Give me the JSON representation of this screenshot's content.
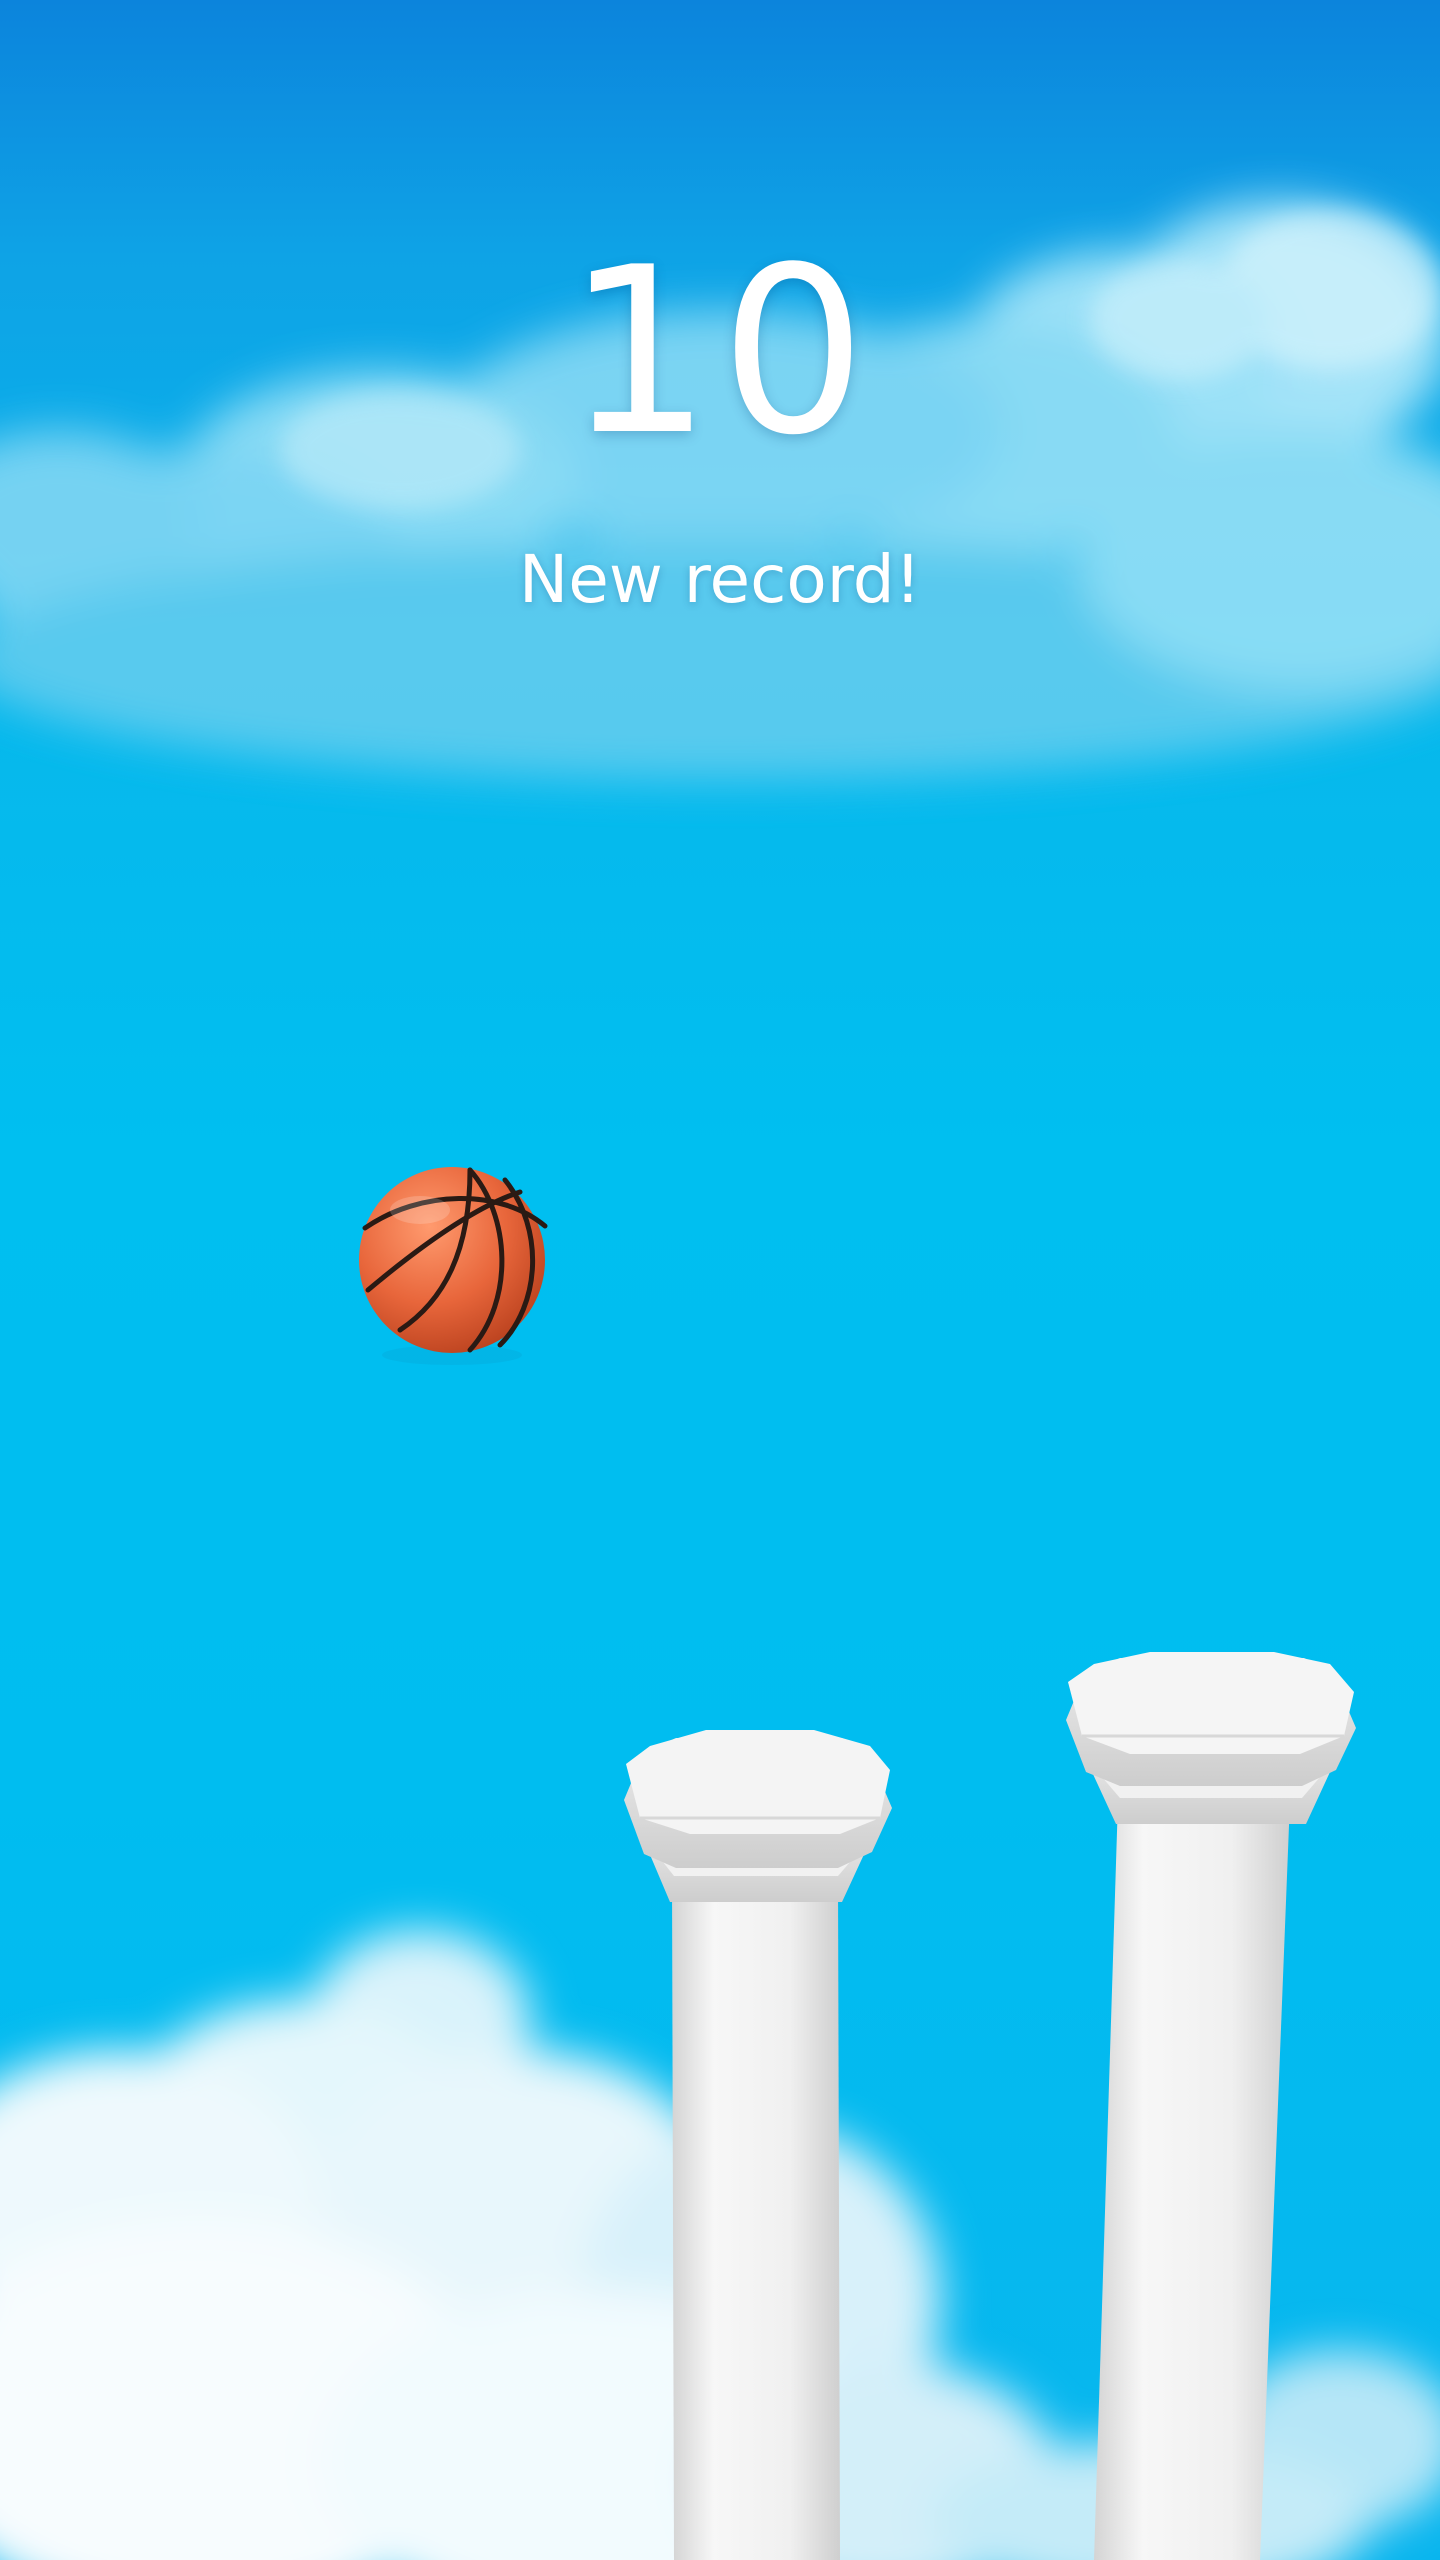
{
  "hud": {
    "score": "10",
    "message": "New record!"
  },
  "scene": {
    "background": "sky-with-clouds",
    "ball": "basketball-icon",
    "pillars": [
      "pillar-near",
      "pillar-far"
    ]
  },
  "colors": {
    "sky_top": "#0c84dc",
    "sky_mid": "#00bff0",
    "ball_orange": "#e8663b",
    "pillar_white": "#f2f2f2",
    "text": "#ffffff"
  }
}
